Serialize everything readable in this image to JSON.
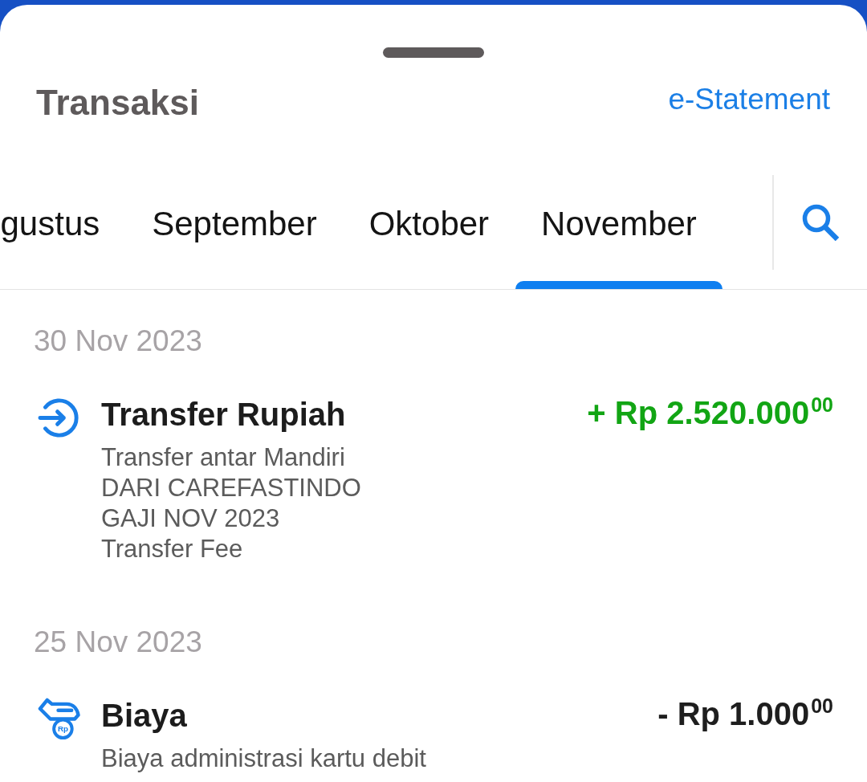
{
  "sheet": {
    "title": "Transaksi",
    "action": "e-Statement"
  },
  "tabs": [
    {
      "label": "gustus",
      "selected": false
    },
    {
      "label": "September",
      "selected": false
    },
    {
      "label": "Oktober",
      "selected": false
    },
    {
      "label": "November",
      "selected": true
    }
  ],
  "groups": [
    {
      "date": "30 Nov 2023",
      "transactions": [
        {
          "kind": "transfer-in",
          "title": "Transfer Rupiah",
          "amount": "+ Rp 2.520.000$^{00}$",
          "details": [
            "Transfer antar Mandiri",
            "DARI CAREFASTINDO",
            "GAJI NOV 2023",
            "Transfer Fee"
          ]
        }
      ]
    },
    {
      "date": "25 Nov 2023",
      "transactions": [
        {
          "kind": "fee",
          "title": "Biaya",
          "icon_text": "Rp",
          "amount": "- Rp 1.000$^{00}$",
          "details": [
            "Biaya administrasi kartu debit"
          ]
        }
      ]
    }
  ]
}
